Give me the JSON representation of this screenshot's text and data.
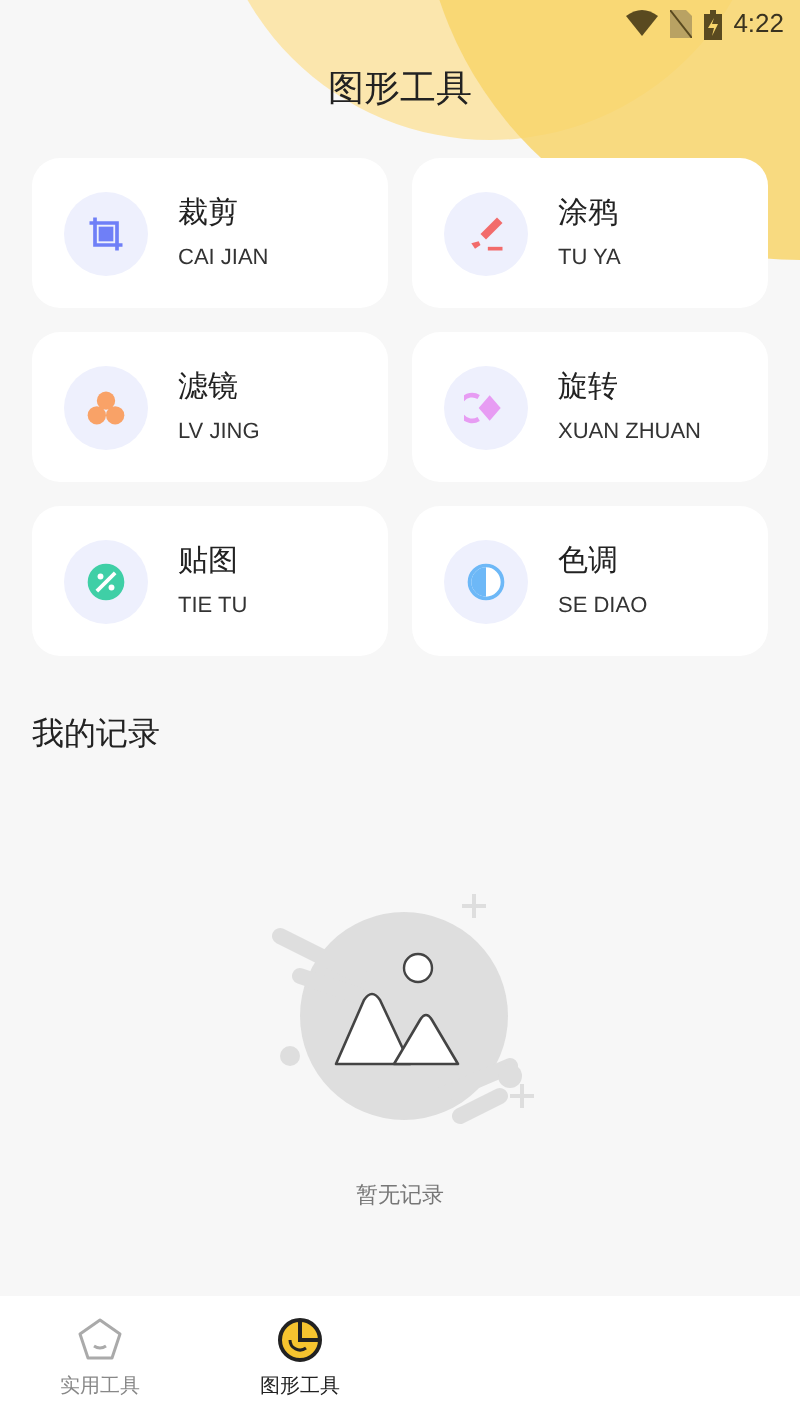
{
  "status_bar": {
    "time": "4:22"
  },
  "header": {
    "title": "图形工具"
  },
  "tools": [
    {
      "kind": "crop",
      "title": "裁剪",
      "subtitle": "CAI JIAN"
    },
    {
      "kind": "brush",
      "title": "涂鸦",
      "subtitle": "TU YA"
    },
    {
      "kind": "filter",
      "title": "滤镜",
      "subtitle": "LV JING"
    },
    {
      "kind": "rotate",
      "title": "旋转",
      "subtitle": "XUAN ZHUAN"
    },
    {
      "kind": "sticker",
      "title": "贴图",
      "subtitle": "TIE TU"
    },
    {
      "kind": "tone",
      "title": "色调",
      "subtitle": "SE DIAO"
    }
  ],
  "records": {
    "heading": "我的记录",
    "empty_text": "暂无记录"
  },
  "bottom_nav": [
    {
      "kind": "home",
      "label": "实用工具",
      "selected": false
    },
    {
      "kind": "pie",
      "label": "图形工具",
      "selected": true
    }
  ]
}
